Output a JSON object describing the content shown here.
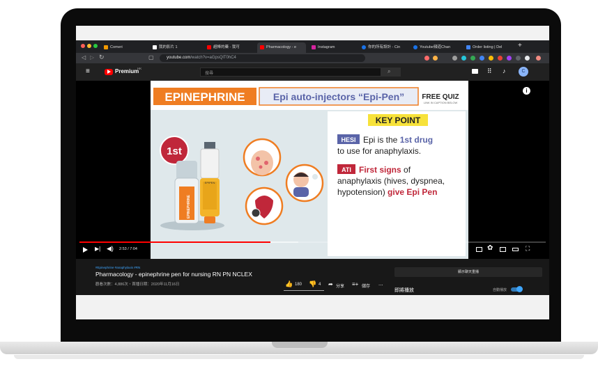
{
  "browser": {
    "tabs": [
      {
        "label": "Comeri",
        "color": "#f29900"
      },
      {
        "label": "我的影片 1",
        "color": "#ffffff"
      },
      {
        "label": "超棒的藥 - 我可",
        "color": "#ff0000"
      },
      {
        "label": "Pharmacology - e",
        "color": "#ff0000"
      },
      {
        "label": "Instagram",
        "color": "#d6249f"
      },
      {
        "label": "你的所有設計 - Cin",
        "color": "#1a73e8"
      },
      {
        "label": "Youtube頻道Chan",
        "color": "#1a73e8"
      },
      {
        "label": "Order listing | Del",
        "color": "#4285f4"
      }
    ],
    "new_tab": "+",
    "tab_close": "×",
    "url_host": "youtube.com",
    "url_path": "/watch?v=aGpsQlT0hC4"
  },
  "youtube": {
    "logo_text": "Premium",
    "logo_suffix": "HK",
    "search_placeholder": "搜尋",
    "avatar_letter": "C"
  },
  "video": {
    "banner_title": "EPINEPHRINE",
    "banner_subtitle": "Epi auto-injectors “Epi-Pen”",
    "quiz_title": "FREE QUIZ",
    "quiz_sub": "LINK IN CAPTION BELOW",
    "first_badge": "1st",
    "pen_label": "EPIPEN",
    "vial_label": "EPINEPHRINE",
    "key_point_title": "KEY POINT",
    "hesi_tag": "HESI",
    "hesi_text_1": "Epi is the ",
    "hesi_highlight": "1st drug",
    "hesi_text_2": "to use for anaphylaxis.",
    "ati_tag": "ATI",
    "ati_highlight": "First signs",
    "ati_text_1": " of",
    "ati_text_2": "anaphylaxis (hives, dyspnea,",
    "ati_text_3": "hypotension) ",
    "ati_highlight_2": "give Epi Pen",
    "time": "2:53 / 7:04",
    "progress": 0.41,
    "buffered": 0.47
  },
  "details": {
    "hashtags": "#Epinephrine #anaphylaxis #RN",
    "title": "Pharmacology - epinephrine pen for nursing RN PN NCLEX",
    "meta": "觀看次數：4,886次・首播日期：2020年11月16日",
    "likes": "180",
    "dislikes": "4",
    "share": "分享",
    "save": "儲存",
    "more": "...",
    "live_chat": "顯示聊天重播",
    "up_next": "即將播放",
    "autoplay": "自動播放"
  },
  "colors": {
    "banner_orange": "#ef7d22",
    "epi_blue": "#5a64a8",
    "key_yellow": "#f7e23a",
    "ati_red": "#c0273a",
    "yt_red": "#ff0000"
  }
}
